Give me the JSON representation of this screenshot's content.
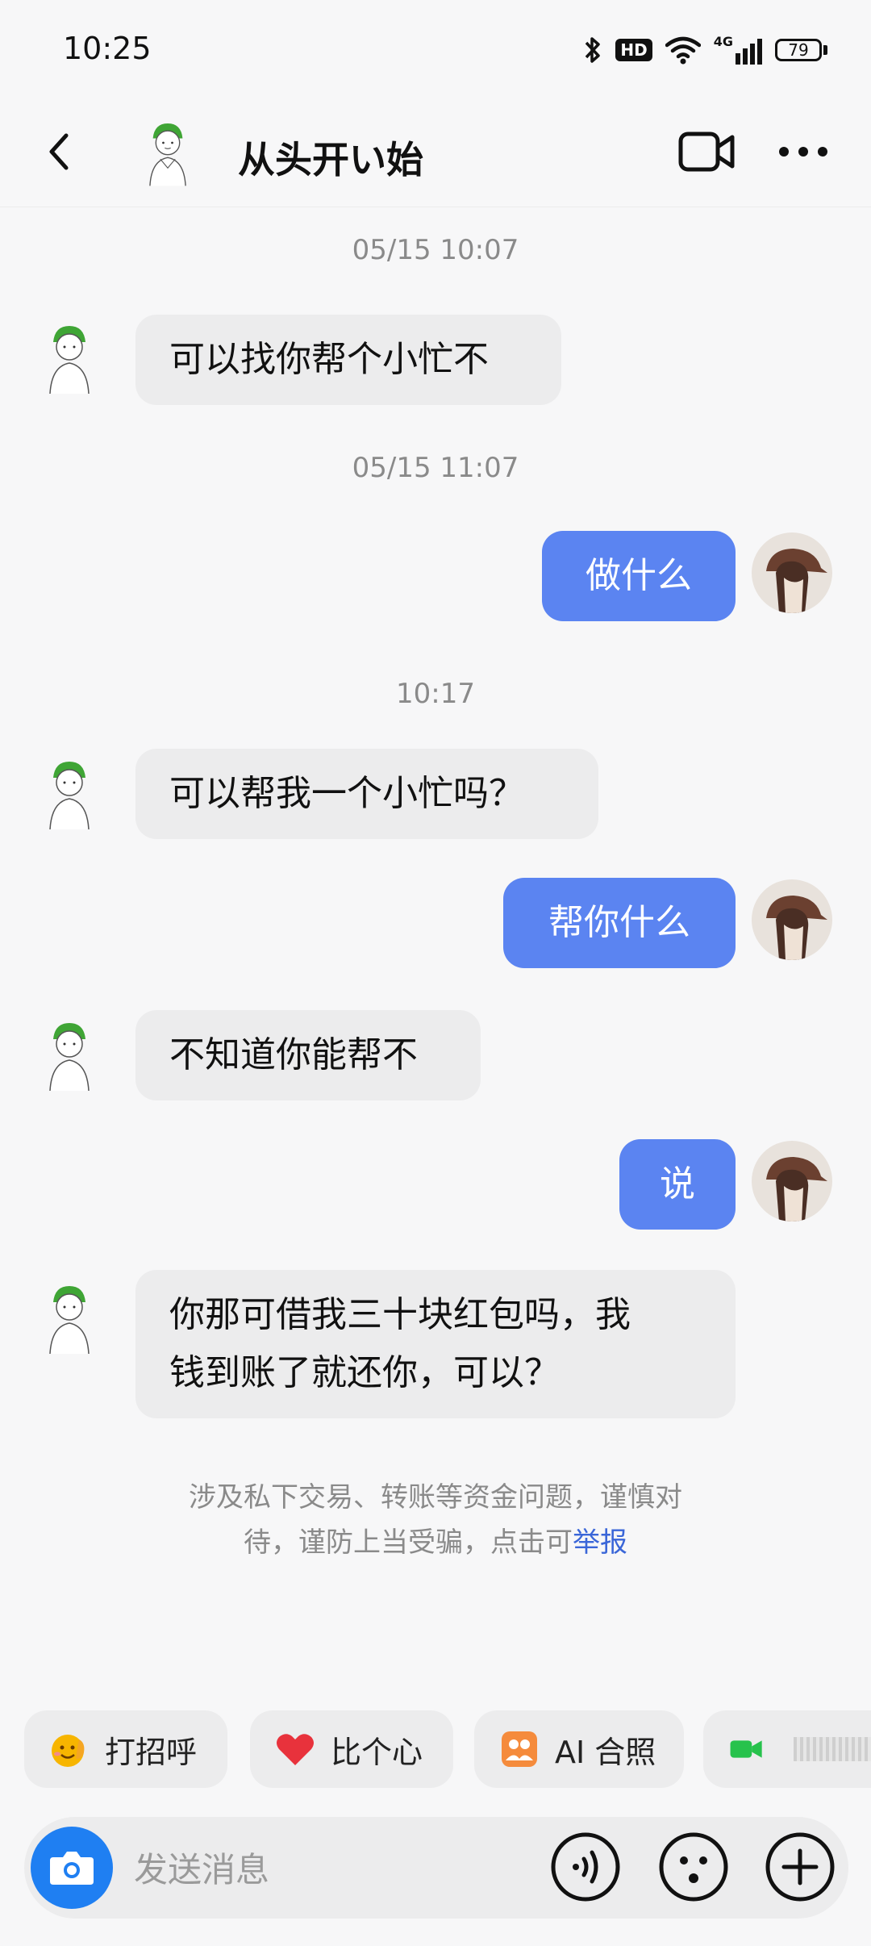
{
  "status_bar": {
    "time": "10:25",
    "hd": "HD",
    "network": "4G",
    "battery": "79",
    "icons": [
      "bluetooth-icon",
      "hd-icon",
      "wifi-icon",
      "signal-4g-icon",
      "battery-icon"
    ]
  },
  "header": {
    "contact_name": "从头开い始",
    "icons": [
      "back-icon",
      "video-call-icon",
      "more-icon"
    ]
  },
  "messages": [
    {
      "type": "timestamp",
      "text": "05/15 10:07"
    },
    {
      "type": "incoming",
      "text": "可以找你帮个小忙不"
    },
    {
      "type": "timestamp",
      "text": "05/15 11:07"
    },
    {
      "type": "outgoing",
      "text": "做什么"
    },
    {
      "type": "timestamp",
      "text": "10:17"
    },
    {
      "type": "incoming",
      "text": "可以帮我一个小忙吗？"
    },
    {
      "type": "outgoing",
      "text": "帮你什么"
    },
    {
      "type": "incoming",
      "text": "不知道你能帮不"
    },
    {
      "type": "outgoing",
      "text": "说"
    },
    {
      "type": "incoming",
      "text_line1": "你那可借我三十块红包吗，我",
      "text_line2": "钱到账了就还你，可以？"
    }
  ],
  "notice": {
    "line1": "涉及私下交易、转账等资金问题，谨慎对",
    "line2_prefix": "待，谨防上当受骗，点击可",
    "report_link": "举报"
  },
  "quick_actions": [
    {
      "label": "打招呼",
      "icon": "wave-emoji-icon"
    },
    {
      "label": "比个心",
      "icon": "heart-icon"
    },
    {
      "label": "AI 合照",
      "icon": "ai-photo-icon"
    },
    {
      "label": "",
      "icon": "video-chat-icon"
    }
  ],
  "input": {
    "placeholder": "发送消息",
    "icons": [
      "camera-icon",
      "voice-icon",
      "emoji-icon",
      "add-icon"
    ]
  },
  "colors": {
    "outgoing_bubble": "#5b84f1",
    "incoming_bubble": "#ececed",
    "link": "#3a66d8",
    "camera_button": "#1f7ff2"
  }
}
